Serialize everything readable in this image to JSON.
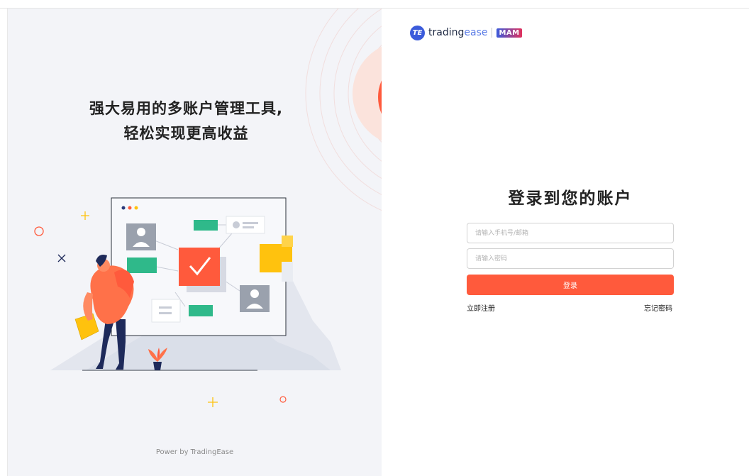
{
  "hero": {
    "headline_line1": "强大易用的多账户管理工具,",
    "headline_line2": "轻松实现更高收益",
    "footer": "Power by TradingEase"
  },
  "brand": {
    "mark": "TE",
    "name_trading": "trading",
    "name_ease": "ease",
    "badge": "MAM"
  },
  "login": {
    "title": "登录到您的账户",
    "phone_placeholder": "请输入手机号/邮箱",
    "password_placeholder": "请输入密码",
    "submit_label": "登录",
    "register_link": "立即注册",
    "forgot_link": "忘记密码"
  },
  "colors": {
    "accent": "#ff5a3c",
    "brand_blue": "#3b5bdb",
    "panel_bg": "#f3f4f8",
    "figure_green": "#2fb98a",
    "figure_yellow": "#ffc20e"
  },
  "icons": [
    "checkmark-icon",
    "user-card-icon",
    "plus-icon",
    "circle-icon",
    "cross-icon"
  ]
}
